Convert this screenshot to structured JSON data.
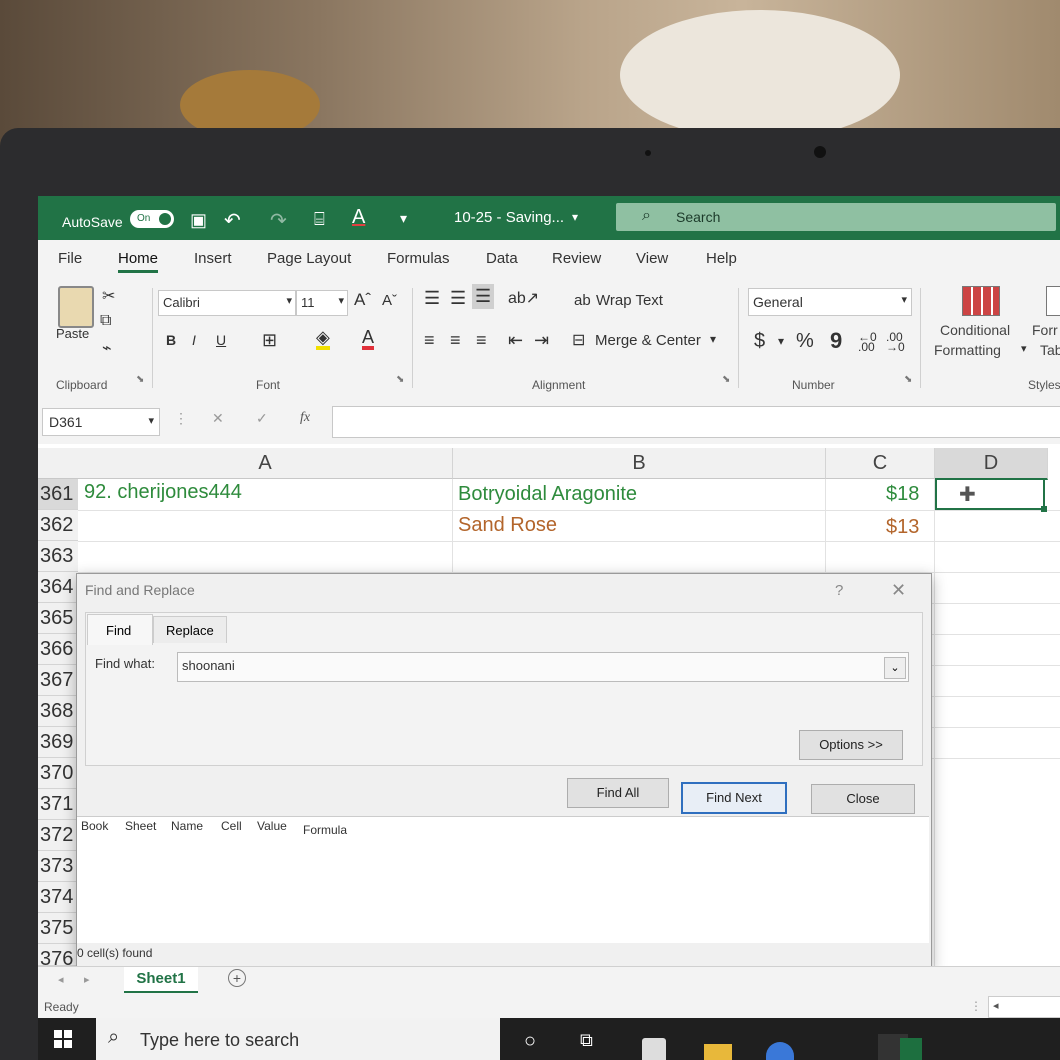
{
  "titlebar": {
    "autosave_label": "AutoSave",
    "autosave_state": "On",
    "doc_title": "10-25 - Saving...",
    "search_placeholder": "Search",
    "accent": "#217346"
  },
  "tabs": [
    "File",
    "Home",
    "Insert",
    "Page Layout",
    "Formulas",
    "Data",
    "Review",
    "View",
    "Help"
  ],
  "ribbon": {
    "paste": "Paste",
    "clipboard": "Clipboard",
    "font_name": "Calibri",
    "font_size": "11",
    "bold": "B",
    "italic": "I",
    "underline": "U",
    "font": "Font",
    "wrap_text": "Wrap Text",
    "merge_center": "Merge & Center",
    "alignment": "Alignment",
    "number_format": "General",
    "currency": "$",
    "percent": "%",
    "comma": "9",
    "number": "Number",
    "conditional_line1": "Conditional",
    "conditional_line2": "Formatting",
    "format_line1": "Forr",
    "format_line2": "Tab",
    "styles": "Styles"
  },
  "formula_bar": {
    "name_box": "D361",
    "fx": "fx",
    "formula": ""
  },
  "columns": [
    "A",
    "B",
    "C",
    "D"
  ],
  "rows": [
    {
      "num": "361",
      "a": "92. cherijones444",
      "b": "Botryoidal Aragonite",
      "c": "$18"
    },
    {
      "num": "362",
      "a": "",
      "b": "Sand Rose",
      "c": "$13"
    },
    {
      "num": "363",
      "a": "",
      "b": "",
      "c": ""
    },
    {
      "num": "364"
    },
    {
      "num": "365"
    },
    {
      "num": "366"
    },
    {
      "num": "367"
    },
    {
      "num": "368"
    },
    {
      "num": "369"
    },
    {
      "num": "370"
    },
    {
      "num": "371"
    },
    {
      "num": "372"
    },
    {
      "num": "373"
    },
    {
      "num": "374"
    },
    {
      "num": "375"
    },
    {
      "num": "376"
    }
  ],
  "dialog": {
    "title": "Find and Replace",
    "help": "?",
    "close": "✕",
    "tab_find": "Find",
    "tab_replace": "Replace",
    "find_what_label": "Find what:",
    "find_what_value": "shoonani",
    "options_button": "Options >>",
    "find_all_button": "Find All",
    "find_next_button": "Find Next",
    "close_button": "Close",
    "result_columns": [
      "Book",
      "Sheet",
      "Name",
      "Cell",
      "Value",
      "Formula"
    ],
    "status": "0 cell(s) found"
  },
  "sheet_tab": "Sheet1",
  "add_sheet": "+",
  "status_text": "Ready",
  "taskbar_search": "Type here to search"
}
